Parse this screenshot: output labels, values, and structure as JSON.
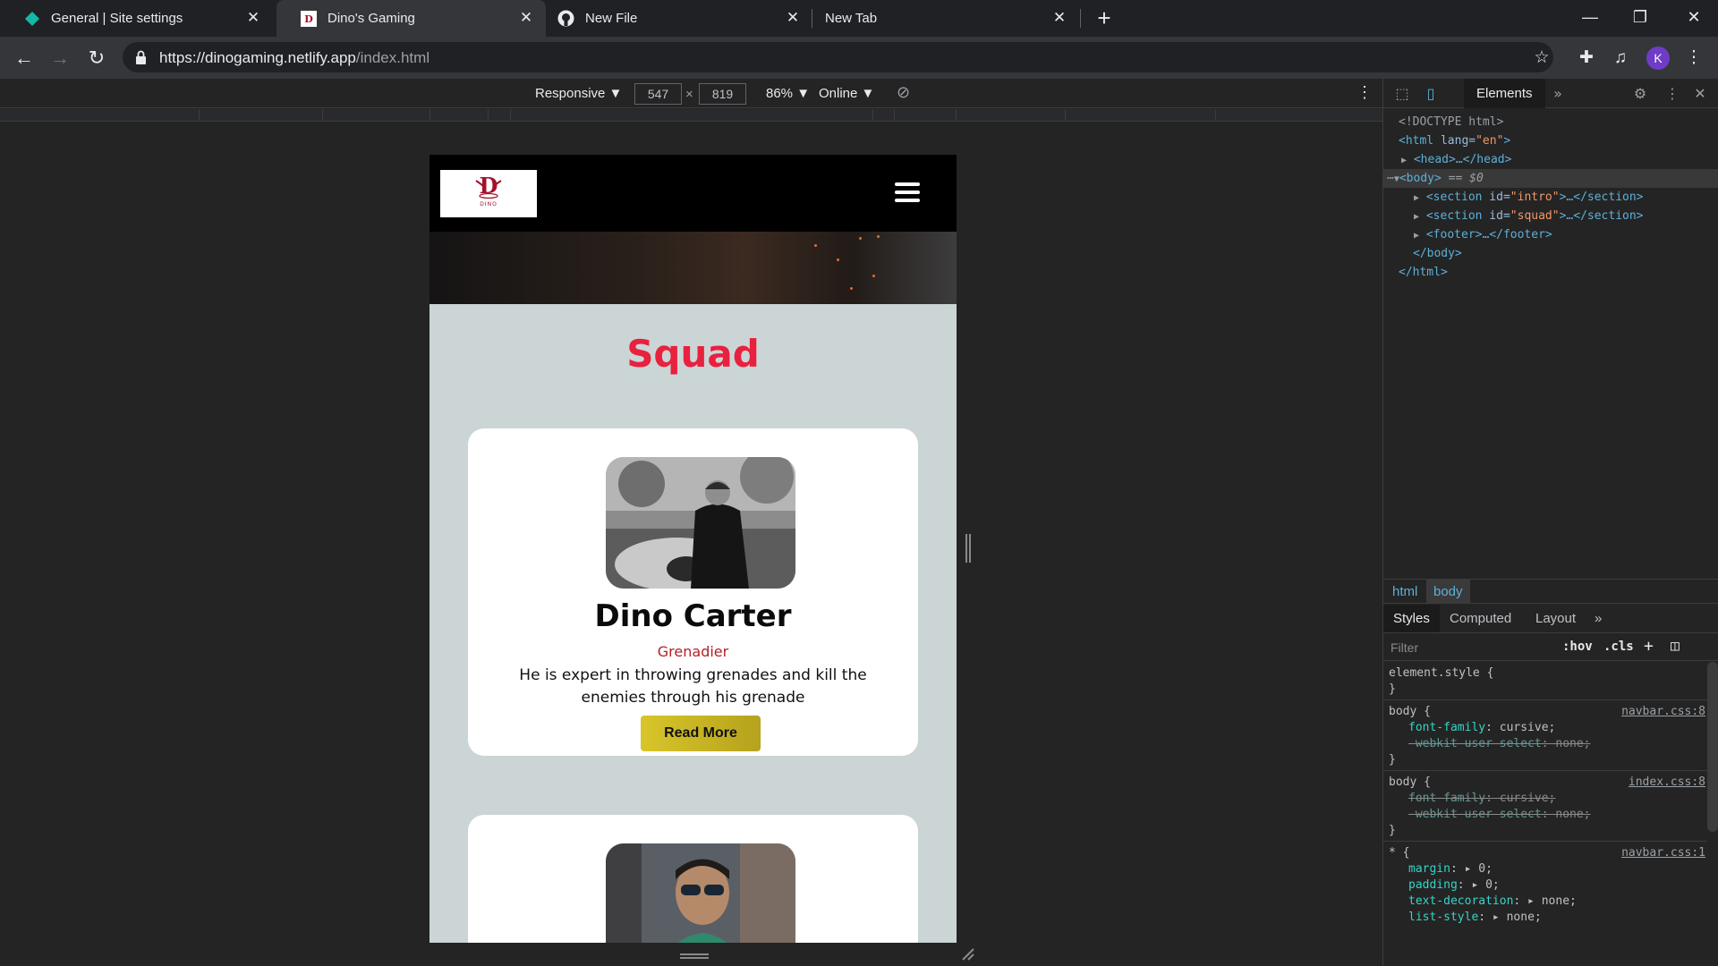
{
  "tabs": [
    {
      "title": "General | Site settings",
      "icon": "netlify-icon"
    },
    {
      "title": "Dino's Gaming",
      "icon": "dino-favicon"
    },
    {
      "title": "New File",
      "icon": "github-icon"
    },
    {
      "title": "New Tab",
      "icon": ""
    }
  ],
  "url": {
    "scheme": "https://",
    "host": "dinogaming.netlify.app",
    "path": "/index.html"
  },
  "profile_initial": "K",
  "device_toolbar": {
    "device": "Responsive",
    "width": "547",
    "height": "819",
    "x_sep": "×",
    "zoom": "86%",
    "throttle": "Online"
  },
  "site": {
    "logo_letter": "D",
    "logo_text": "DINO",
    "section_title": "Squad",
    "cards": [
      {
        "name": "Dino Carter",
        "role": "Grenadier",
        "description": "He is expert in throwing grenades and kill the enemies through his grenade",
        "button": "Read More"
      }
    ]
  },
  "devtools": {
    "active_tab": "Elements",
    "tree": {
      "doctype": "<!DOCTYPE html>",
      "html_open_tag": "<html",
      "html_attr": " lang=",
      "html_attr_val": "\"en\"",
      "html_open_close": ">",
      "head": "<head>…</head>",
      "body_open": "<body>",
      "body_marker": " == $0",
      "section_tag": "<section",
      "section_attr": " id=",
      "section1_val": "\"intro\"",
      "section2_val": "\"squad\"",
      "section_close": ">…</section>",
      "footer": "<footer>…</footer>",
      "body_close": "</body>",
      "html_close": "</html>"
    },
    "breadcrumbs": [
      "html",
      "body"
    ],
    "style_tabs": [
      "Styles",
      "Computed",
      "Layout"
    ],
    "filter_placeholder": "Filter",
    "hov": ":hov",
    "cls": ".cls",
    "rules": {
      "element_style_sel": "element.style {",
      "close": "}",
      "body_sel": "body {",
      "r1_src": "navbar.css:8",
      "r1_p1_name": "font-family",
      "r1_p1_val": ": cursive;",
      "r1_p2_name": "-webkit-user-select",
      "r1_p2_val": ": none;",
      "r2_src": "index.css:8",
      "star_sel": "* {",
      "r3_src": "navbar.css:1",
      "r3_p1_name": "margin",
      "r3_p1_val": ": ▸ 0;",
      "r3_p2_name": "padding",
      "r3_p2_val": ": ▸ 0;",
      "r3_p3_name": "text-decoration",
      "r3_p3_val": ": ▸ none;",
      "r3_p4_name": "list-style",
      "r3_p4_val": ": ▸ none;"
    }
  },
  "colors": {
    "accent_title": "#e8213f",
    "role_text": "#b32026",
    "button_gold": "#d8c52a",
    "page_bg": "#cbd5d6"
  }
}
